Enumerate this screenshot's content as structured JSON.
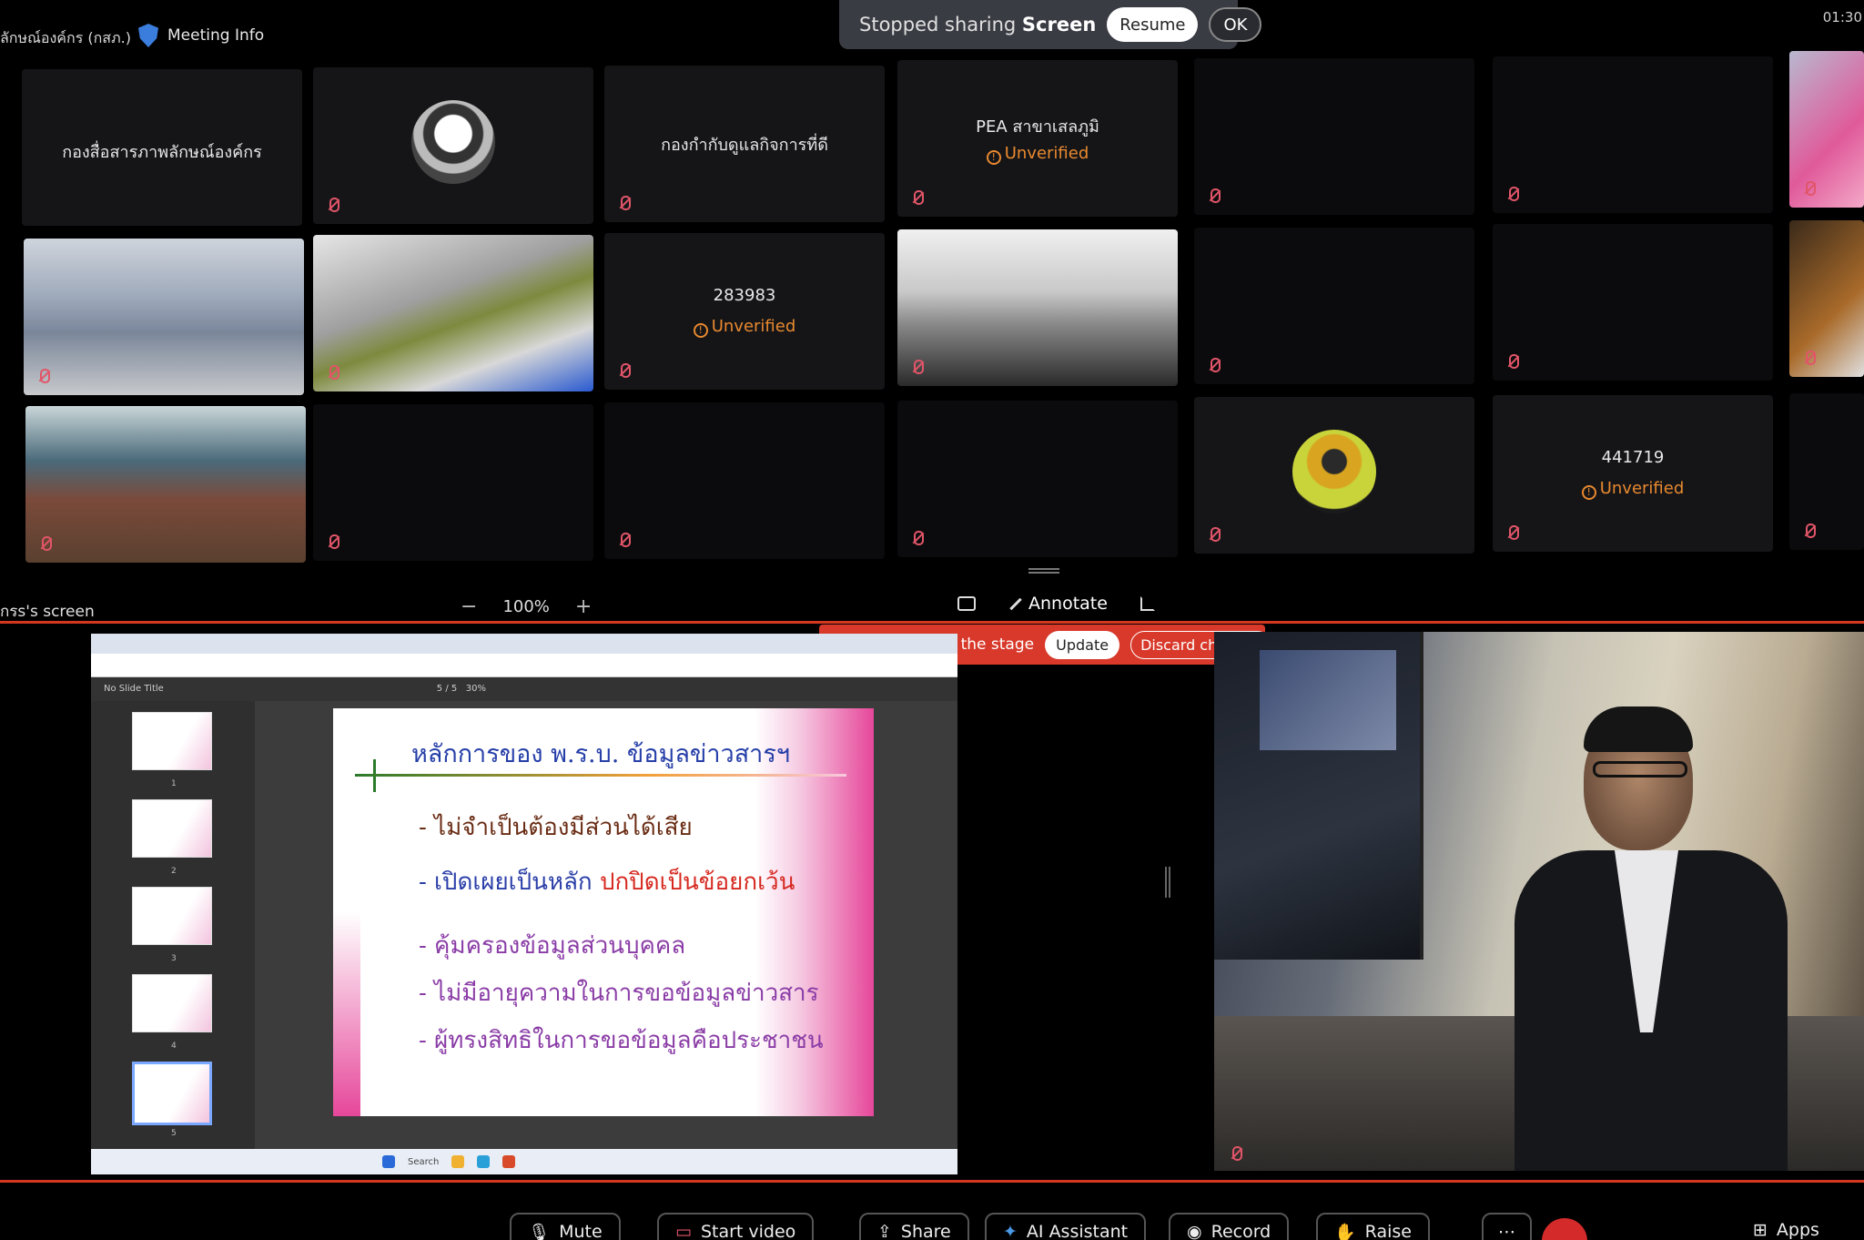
{
  "header": {
    "org_title": "ลักษณ์องค์กร (กสภ.)",
    "meeting_info_label": "Meeting Info",
    "share_status_prefix": "Stopped sharing",
    "share_status_object": "Screen",
    "resume_label": "Resume",
    "ok_label": "OK",
    "clock": "01:30"
  },
  "tiles": [
    {
      "name": "กองสื่อสารภาพลักษณ์องค์กร",
      "status": ""
    },
    {
      "name": "",
      "status": ""
    },
    {
      "name": "กองกำกับดูแลกิจการที่ดี",
      "status": ""
    },
    {
      "name": "PEA สาขาเสลภูมิ",
      "status": "Unverified"
    },
    {
      "name": "283983",
      "status": "Unverified"
    },
    {
      "name": "441719",
      "status": "Unverified"
    }
  ],
  "stage": {
    "screen_label": "กรs's screen",
    "zoom_out": "−",
    "zoom_value": "100%",
    "zoom_in": "+",
    "annotate_label": "Annotate",
    "toast_text": "You customized the stage",
    "update_label": "Update",
    "discard_label": "Discard changes"
  },
  "shared_slide": {
    "title": "หลักการของ พ.ร.บ. ข้อมูลข่าวสารฯ",
    "bullet_1": "- ไม่จำเป็นต้องมีส่วนได้เสีย",
    "bullet_2a": "- เปิดเผยเป็นหลัก",
    "bullet_2b": "ปกปิดเป็นข้อยกเว้น",
    "bullet_3": "- คุ้มครองข้อมูลส่วนบุคคล",
    "bullet_4": "- ไม่มีอายุความในการขอข้อมูลข่าวสาร",
    "bullet_5": "- ผู้ทรงสิทธิในการขอข้อมูลคือประชาชน",
    "pdf_title": "No Slide Title",
    "pdf_page": "5 / 5",
    "pdf_zoom": "30%",
    "taskbar_search": "Search",
    "thumb_numbers": [
      "1",
      "2",
      "3",
      "4",
      "5"
    ]
  },
  "toolbar": {
    "mute": "Mute",
    "start_video": "Start video",
    "share": "Share",
    "ai_assistant": "AI Assistant",
    "record": "Record",
    "raise": "Raise",
    "apps": "Apps"
  }
}
